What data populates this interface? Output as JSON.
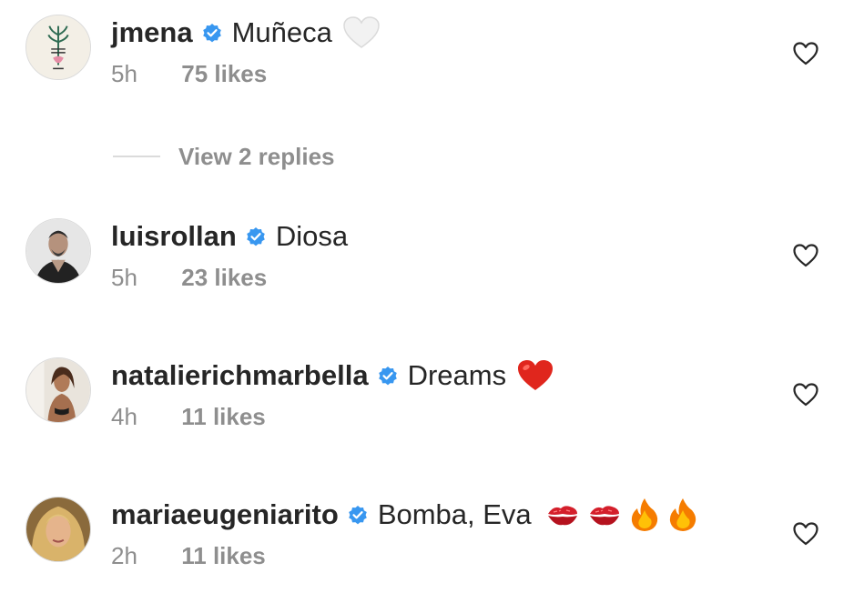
{
  "comments": [
    {
      "username": "jmena",
      "text": "Muñeca",
      "emojis": [
        "white-heart"
      ],
      "time": "5h",
      "likes": "75 likes"
    },
    {
      "username": "luisrollan",
      "text": "Diosa",
      "emojis": [],
      "time": "5h",
      "likes": "23 likes"
    },
    {
      "username": "natalierichmarbella",
      "text": "Dreams",
      "emojis": [
        "red-heart"
      ],
      "time": "4h",
      "likes": "11 likes"
    },
    {
      "username": "mariaeugeniarito",
      "text": "Bomba, Eva",
      "emojis": [
        "kiss-mark",
        "kiss-mark",
        "fire",
        "fire"
      ],
      "time": "2h",
      "likes": "11 likes"
    }
  ],
  "view_replies": "View 2 replies",
  "colors": {
    "verified": "#3897f0",
    "secondary_text": "#8e8e8e",
    "red_heart": "#e0261d",
    "fire": "#f57c00"
  }
}
